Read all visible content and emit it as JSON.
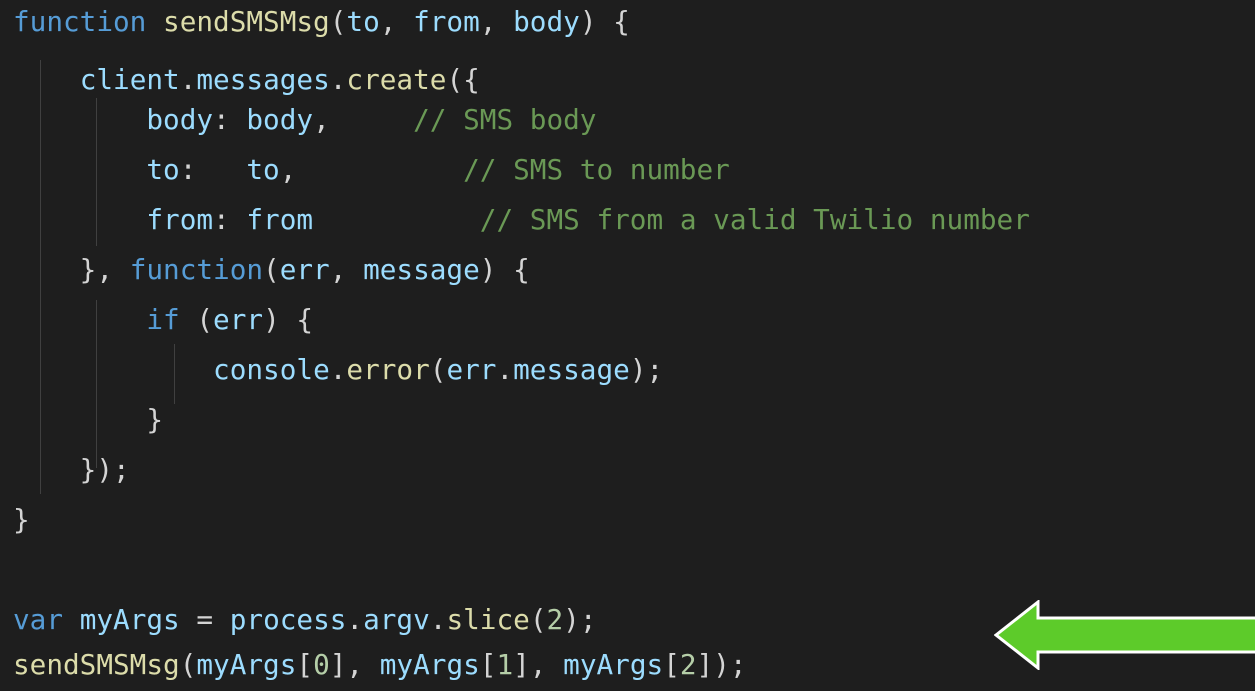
{
  "code": {
    "lines": [
      [
        {
          "cls": "kw",
          "t": "function"
        },
        {
          "cls": "pn",
          "t": " "
        },
        {
          "cls": "fn",
          "t": "sendSMSMsg"
        },
        {
          "cls": "pn",
          "t": "("
        },
        {
          "cls": "var",
          "t": "to"
        },
        {
          "cls": "pn",
          "t": ", "
        },
        {
          "cls": "var",
          "t": "from"
        },
        {
          "cls": "pn",
          "t": ", "
        },
        {
          "cls": "var",
          "t": "body"
        },
        {
          "cls": "pn",
          "t": ") {"
        }
      ],
      [
        {
          "cls": "pn",
          "t": "    "
        },
        {
          "cls": "var",
          "t": "client"
        },
        {
          "cls": "pn",
          "t": "."
        },
        {
          "cls": "var",
          "t": "messages"
        },
        {
          "cls": "pn",
          "t": "."
        },
        {
          "cls": "fn",
          "t": "create"
        },
        {
          "cls": "pn",
          "t": "({"
        }
      ],
      [
        {
          "cls": "pn",
          "t": "        "
        },
        {
          "cls": "var",
          "t": "body"
        },
        {
          "cls": "pn",
          "t": ": "
        },
        {
          "cls": "var",
          "t": "body"
        },
        {
          "cls": "pn",
          "t": ",     "
        },
        {
          "cls": "cm",
          "t": "// SMS body"
        }
      ],
      [
        {
          "cls": "pn",
          "t": "        "
        },
        {
          "cls": "var",
          "t": "to"
        },
        {
          "cls": "pn",
          "t": ":   "
        },
        {
          "cls": "var",
          "t": "to"
        },
        {
          "cls": "pn",
          "t": ",          "
        },
        {
          "cls": "cm",
          "t": "// SMS to number"
        }
      ],
      [
        {
          "cls": "pn",
          "t": "        "
        },
        {
          "cls": "var",
          "t": "from"
        },
        {
          "cls": "pn",
          "t": ": "
        },
        {
          "cls": "var",
          "t": "from"
        },
        {
          "cls": "pn",
          "t": "          "
        },
        {
          "cls": "cm",
          "t": "// SMS from a valid Twilio number"
        }
      ],
      [
        {
          "cls": "pn",
          "t": "    }, "
        },
        {
          "cls": "kw",
          "t": "function"
        },
        {
          "cls": "pn",
          "t": "("
        },
        {
          "cls": "var",
          "t": "err"
        },
        {
          "cls": "pn",
          "t": ", "
        },
        {
          "cls": "var",
          "t": "message"
        },
        {
          "cls": "pn",
          "t": ") {"
        }
      ],
      [
        {
          "cls": "pn",
          "t": "        "
        },
        {
          "cls": "kw",
          "t": "if"
        },
        {
          "cls": "pn",
          "t": " ("
        },
        {
          "cls": "var",
          "t": "err"
        },
        {
          "cls": "pn",
          "t": ") {"
        }
      ],
      [
        {
          "cls": "pn",
          "t": "            "
        },
        {
          "cls": "var",
          "t": "console"
        },
        {
          "cls": "pn",
          "t": "."
        },
        {
          "cls": "fn",
          "t": "error"
        },
        {
          "cls": "pn",
          "t": "("
        },
        {
          "cls": "var",
          "t": "err"
        },
        {
          "cls": "pn",
          "t": "."
        },
        {
          "cls": "var",
          "t": "message"
        },
        {
          "cls": "pn",
          "t": ");"
        }
      ],
      [
        {
          "cls": "pn",
          "t": "        }"
        }
      ],
      [
        {
          "cls": "pn",
          "t": "    });"
        }
      ],
      [
        {
          "cls": "pn",
          "t": "}"
        }
      ],
      [],
      [
        {
          "cls": "kw",
          "t": "var"
        },
        {
          "cls": "pn",
          "t": " "
        },
        {
          "cls": "var",
          "t": "myArgs"
        },
        {
          "cls": "pn",
          "t": " = "
        },
        {
          "cls": "var",
          "t": "process"
        },
        {
          "cls": "pn",
          "t": "."
        },
        {
          "cls": "var",
          "t": "argv"
        },
        {
          "cls": "pn",
          "t": "."
        },
        {
          "cls": "fn",
          "t": "slice"
        },
        {
          "cls": "pn",
          "t": "("
        },
        {
          "cls": "num",
          "t": "2"
        },
        {
          "cls": "pn",
          "t": ");"
        }
      ],
      [
        {
          "cls": "fn",
          "t": "sendSMSMsg"
        },
        {
          "cls": "pn",
          "t": "("
        },
        {
          "cls": "var",
          "t": "myArgs"
        },
        {
          "cls": "pn",
          "t": "["
        },
        {
          "cls": "num",
          "t": "0"
        },
        {
          "cls": "pn",
          "t": "], "
        },
        {
          "cls": "var",
          "t": "myArgs"
        },
        {
          "cls": "pn",
          "t": "["
        },
        {
          "cls": "num",
          "t": "1"
        },
        {
          "cls": "pn",
          "t": "], "
        },
        {
          "cls": "var",
          "t": "myArgs"
        },
        {
          "cls": "pn",
          "t": "["
        },
        {
          "cls": "num",
          "t": "2"
        },
        {
          "cls": "pn",
          "t": "]);"
        }
      ]
    ]
  },
  "colors": {
    "background": "#1e1e1e",
    "keyword": "#569cd6",
    "function": "#dcdcaa",
    "variable": "#9cdcfe",
    "comment": "#6a9955",
    "number": "#b5cea8",
    "punctuation": "#d4d4d4",
    "indent_guide": "#404040",
    "arrow_fill": "#5dcb2a",
    "arrow_stroke": "#ffffff"
  },
  "annotations": {
    "arrow_icon": "left-arrow-icon",
    "arrow_direction": "left"
  }
}
